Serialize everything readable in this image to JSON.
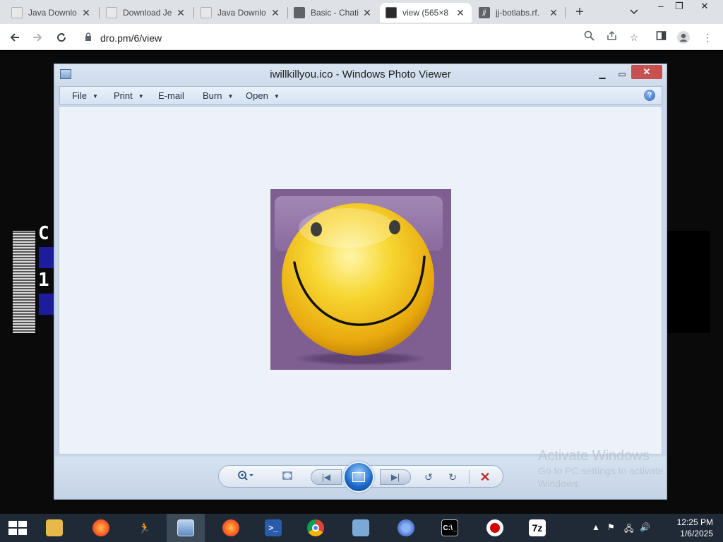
{
  "browser": {
    "tabs": [
      {
        "title": "Java Downlo",
        "icon": "java-icon",
        "active": false
      },
      {
        "title": "Download Je",
        "icon": "java-icon",
        "active": false
      },
      {
        "title": "Java Downlo",
        "icon": "java-icon",
        "active": false
      },
      {
        "title": "Basic - Chati",
        "icon": "globe-icon",
        "active": false
      },
      {
        "title": "view (565×8",
        "icon": "terminal-icon",
        "active": true
      },
      {
        "title": "jj-botlabs.rf.",
        "icon": "jj-icon",
        "active": false
      }
    ],
    "tab_close_glyph": "✕",
    "new_tab_glyph": "+",
    "url": "dro.pm/6/view"
  },
  "page_fragments": {
    "frag1": "C",
    "frag2": "1"
  },
  "viewer": {
    "title": "iwillkillyou.ico - Windows Photo Viewer",
    "menu": [
      {
        "label": "File",
        "has_dropdown": true
      },
      {
        "label": "Print",
        "has_dropdown": true
      },
      {
        "label": "E-mail",
        "has_dropdown": false
      },
      {
        "label": "Burn",
        "has_dropdown": true
      },
      {
        "label": "Open",
        "has_dropdown": true
      }
    ],
    "help_glyph": "?",
    "image_subject": "yellow smiley face on purple background"
  },
  "watermark": {
    "title": "Activate Windows",
    "subtitle": "Go to PC settings to activate Windows."
  },
  "taskbar": {
    "apps": [
      "file-explorer",
      "firefox",
      "runner-app",
      "photo-viewer",
      "firefox",
      "powershell",
      "chrome",
      "network-app",
      "chromium",
      "command-prompt",
      "recorder",
      "7zip"
    ],
    "app_7z_label": "7z",
    "time": "12:25 PM",
    "date": "1/6/2025"
  },
  "colors": {
    "taskbar": "#1f2a36",
    "close_red": "#c75050",
    "delete_red": "#c62828",
    "photo_bg": "#7f5f92",
    "smiley_yellow": "#f2c318"
  }
}
